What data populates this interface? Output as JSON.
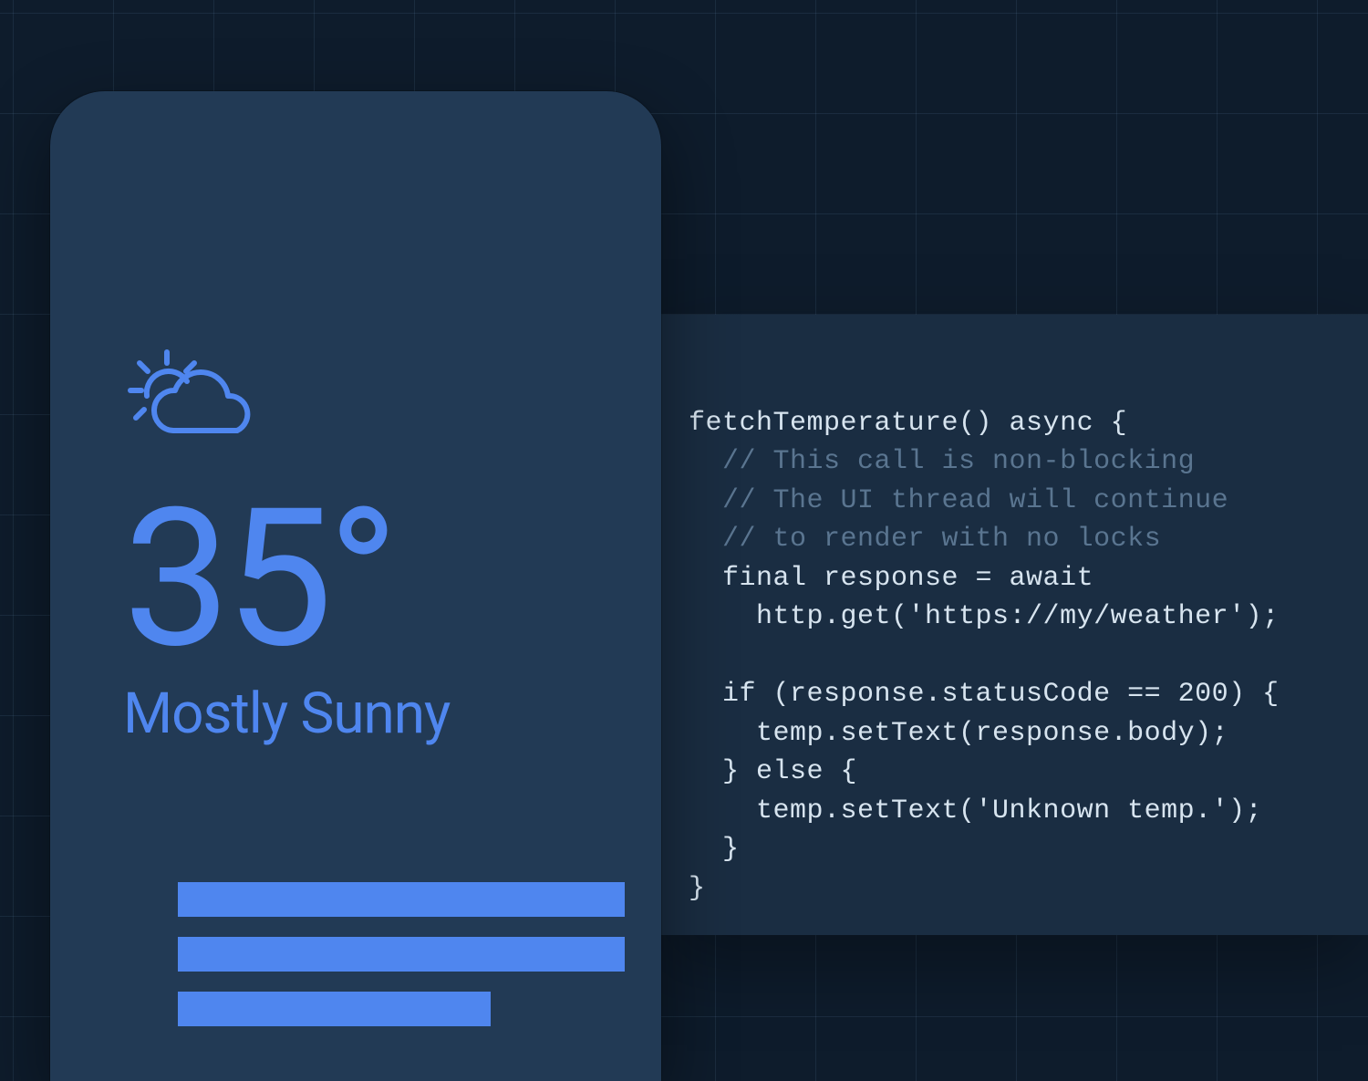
{
  "colors": {
    "bg": "#0e1c2c",
    "phone": "#223a55",
    "accent": "#4f86ef",
    "panel": "#1a2d42",
    "code_text": "#d7e4ef",
    "code_comment": "#5a7590"
  },
  "weather": {
    "icon": "sun-cloud-icon",
    "temperature": "35°",
    "condition": "Mostly Sunny"
  },
  "code": {
    "l0": "fetchTemperature() async {",
    "l1": "  // This call is non-blocking",
    "l2": "  // The UI thread will continue",
    "l3": "  // to render with no locks",
    "l4": "  final response = await",
    "l5": "    http.get('https://my/weather');",
    "l6": "",
    "l7": "  if (response.statusCode == 200) {",
    "l8": "    temp.setText(response.body);",
    "l9": "  } else {",
    "l10": "    temp.setText('Unknown temp.');",
    "l11": "  }",
    "l12": "}"
  }
}
